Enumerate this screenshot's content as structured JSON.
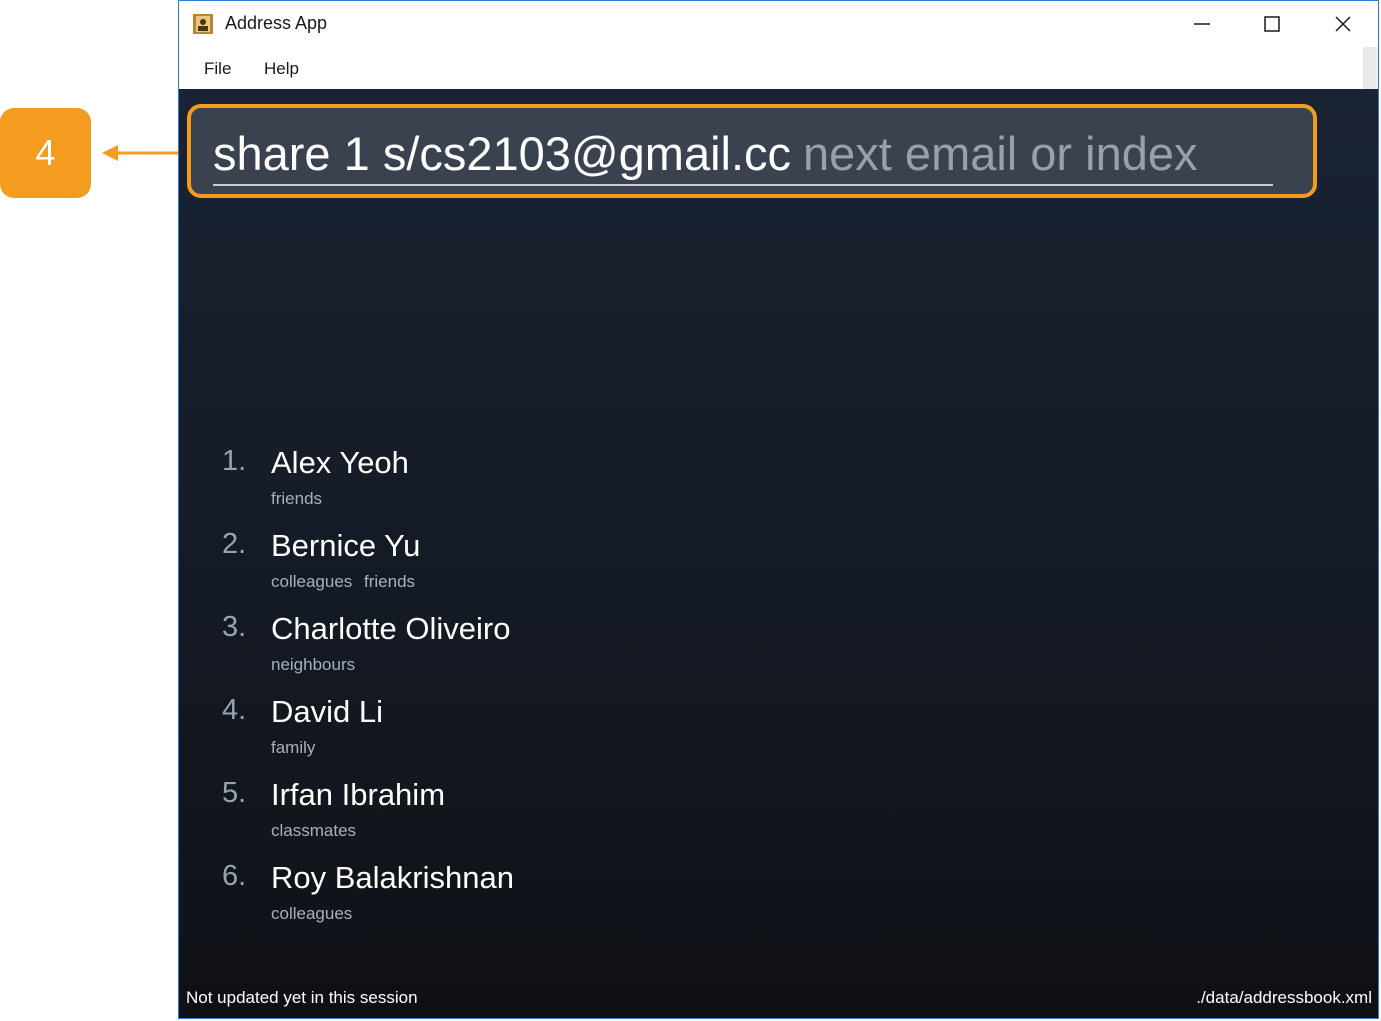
{
  "callout": {
    "label": "4",
    "color": "#f39c1f"
  },
  "window": {
    "title": "Address App"
  },
  "menu": {
    "file": "File",
    "help": "Help"
  },
  "command": {
    "typed": "share 1 s/cs2103@gmail.cc",
    "suggestion": "next email or index"
  },
  "persons": [
    {
      "index": "1.",
      "name": "Alex Yeoh",
      "tags": [
        "friends"
      ]
    },
    {
      "index": "2.",
      "name": "Bernice Yu",
      "tags": [
        "colleagues",
        "friends"
      ]
    },
    {
      "index": "3.",
      "name": "Charlotte Oliveiro",
      "tags": [
        "neighbours"
      ]
    },
    {
      "index": "4.",
      "name": "David Li",
      "tags": [
        "family"
      ]
    },
    {
      "index": "5.",
      "name": "Irfan Ibrahim",
      "tags": [
        "classmates"
      ]
    },
    {
      "index": "6.",
      "name": "Roy Balakrishnan",
      "tags": [
        "colleagues"
      ]
    }
  ],
  "status": {
    "left": "Not updated yet in this session",
    "right": "./data/addressbook.xml"
  },
  "icons": [
    "app-icon",
    "minimize-icon",
    "maximize-icon",
    "close-icon"
  ]
}
